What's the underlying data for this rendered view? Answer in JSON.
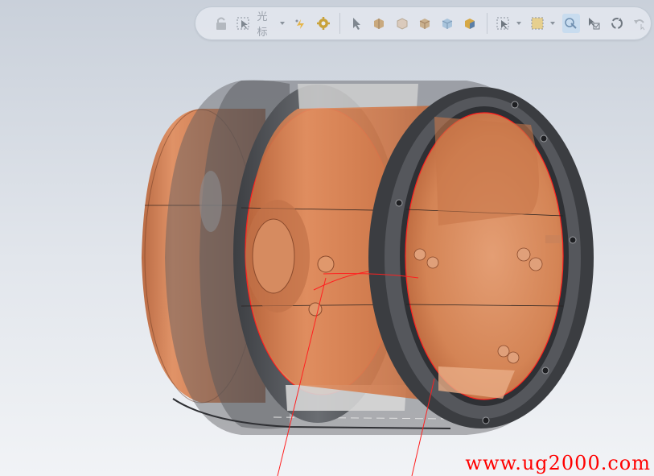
{
  "toolbar": {
    "cursor_label": "光标",
    "buttons": [
      "lock-icon",
      "select-cursor-icon",
      "snap-icon",
      "settings-gear-icon",
      "pointer-icon",
      "shaded-view-icon",
      "wireframe-view-icon",
      "solid-view-icon",
      "transparent-view-icon",
      "render-view-icon",
      "selection-filter-icon",
      "box-select-icon",
      "show-hidden-icon",
      "select-checkbox-icon",
      "rotate-view-icon",
      "undo-icon"
    ]
  },
  "watermark": {
    "text": "www.ug2000.com",
    "color": "#ff0000"
  },
  "colors": {
    "model_copper": "#d88a5c",
    "flange_gray": "#4a4c50",
    "edge_highlight": "#ff2020",
    "background_top": "#c9d0da",
    "background_bottom": "#f1f3f6"
  }
}
